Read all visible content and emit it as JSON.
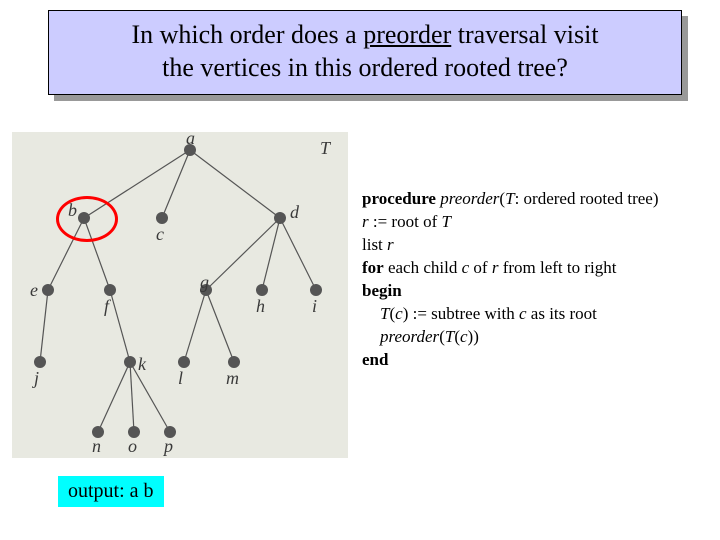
{
  "title": {
    "line1_pre": "In which order does a ",
    "line1_u": "preorder",
    "line1_post": " traversal visit",
    "line2": "the vertices in this ordered rooted tree?"
  },
  "tree": {
    "label_T": "T",
    "nodes": {
      "a": "a",
      "b": "b",
      "c": "c",
      "d": "d",
      "e": "e",
      "f": "f",
      "g": "g",
      "h": "h",
      "i": "i",
      "j": "j",
      "k": "k",
      "l": "l",
      "m": "m",
      "n": "n",
      "o": "o",
      "p": "p"
    }
  },
  "algo": {
    "l1_kw": "procedure ",
    "l1_it": "preorder",
    "l1_rest_a": "(",
    "l1_rest_it": "T",
    "l1_rest_b": ": ordered rooted tree)",
    "l2_a": "r",
    "l2_b": " := root of ",
    "l2_c": "T",
    "l3_a": "list ",
    "l3_b": "r",
    "l4_kw": "for",
    "l4_a": " each child ",
    "l4_b": "c",
    "l4_c": " of ",
    "l4_d": "r",
    "l4_e": " from left to right",
    "l5": "begin",
    "l6_a": "T",
    "l6_b": "(",
    "l6_c": "c",
    "l6_d": ") := subtree with ",
    "l6_e": "c",
    "l6_f": " as its root",
    "l7_a": "preorder",
    "l7_b": "(",
    "l7_c": "T",
    "l7_d": "(",
    "l7_e": "c",
    "l7_f": "))",
    "l8": "end"
  },
  "output": "output: a b"
}
